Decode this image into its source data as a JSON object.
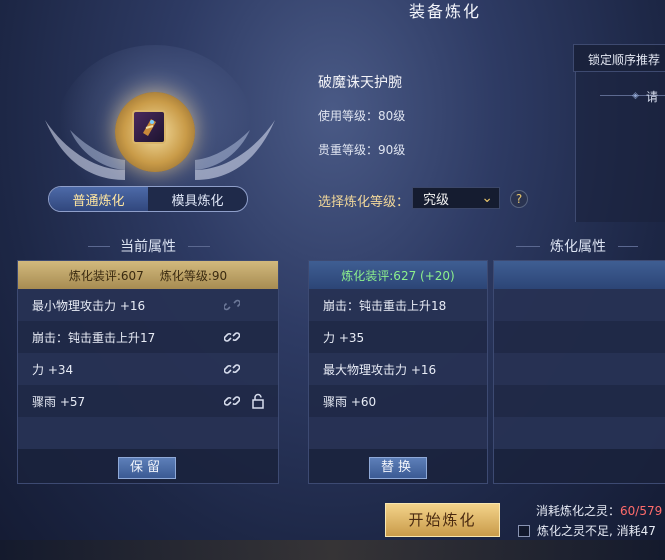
{
  "window": {
    "title": "装备炼化"
  },
  "emblem": {
    "item_icon": "bracer-icon"
  },
  "tabs": [
    {
      "label": "普通炼化",
      "active": true
    },
    {
      "label": "模具炼化",
      "active": false
    }
  ],
  "item": {
    "name": "破魔诛天护腕",
    "use_level": "使用等级：80级",
    "rarity_level": "贵重等级：90级"
  },
  "refine_level": {
    "label": "选择炼化等级：",
    "value": "究级",
    "help": "?"
  },
  "side_panel": {
    "lock_order": "锁定顺序推荐",
    "hint": "请"
  },
  "sections": {
    "current": "当前属性",
    "refined": "炼化属性"
  },
  "current_panel": {
    "score": "炼化装评:607",
    "level": "炼化等级:90",
    "rows": [
      {
        "text": "最小物理攻击力 +16",
        "linked": false,
        "lock": false
      },
      {
        "text": "崩击：钝击重击上升17",
        "linked": true,
        "lock": false
      },
      {
        "text": "力 +34",
        "linked": true,
        "lock": false
      },
      {
        "text": "骤雨 +57",
        "linked": true,
        "lock": true
      }
    ],
    "button": "保留"
  },
  "refined_panel": {
    "score": "炼化装评:627 (+20)",
    "rows": [
      {
        "text": "崩击：钝击重击上升18"
      },
      {
        "text": "力 +35"
      },
      {
        "text": "最大物理攻击力 +16"
      },
      {
        "text": "骤雨 +60"
      }
    ],
    "button": "替换"
  },
  "actions": {
    "start": "开始炼化",
    "cost_label": "消耗炼化之灵：",
    "cost_value": "60/579",
    "insufficient": "炼化之灵不足, 消耗47"
  },
  "colors": {
    "accent_gold": "#e8c66c",
    "positive_green": "#8cf08c",
    "cost_red": "#ff6b6b"
  }
}
